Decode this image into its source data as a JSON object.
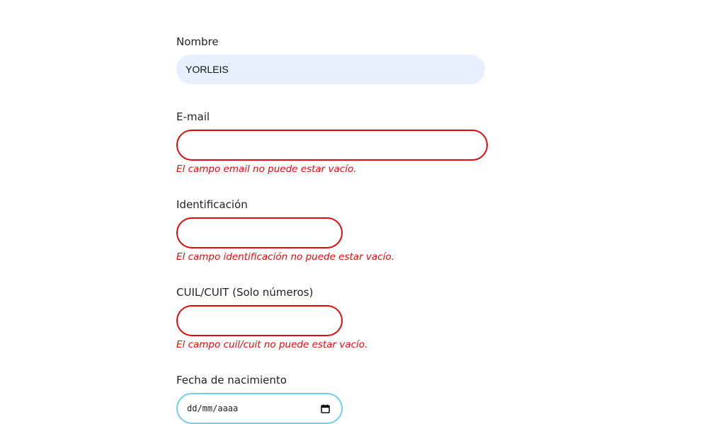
{
  "form": {
    "nombre": {
      "label": "Nombre",
      "value": "YORLEIS"
    },
    "email": {
      "label": "E-mail",
      "value": "",
      "error": "El campo email no puede estar vacío."
    },
    "identificacion": {
      "label": "Identificación",
      "value": "",
      "error": "El campo identificación no puede estar vacío."
    },
    "cuil": {
      "label": "CUIL/CUIT (Solo números)",
      "value": "",
      "error": "El campo cuil/cuit no puede estar vacío."
    },
    "fecha": {
      "label": "Fecha de nacimiento",
      "placeholder": "dd/mm/aaaa",
      "icon": "calendar-icon"
    }
  },
  "colors": {
    "error": "#e4080a",
    "filled_background": "#e8f0fe",
    "focus_border": "#6fd0ee"
  }
}
